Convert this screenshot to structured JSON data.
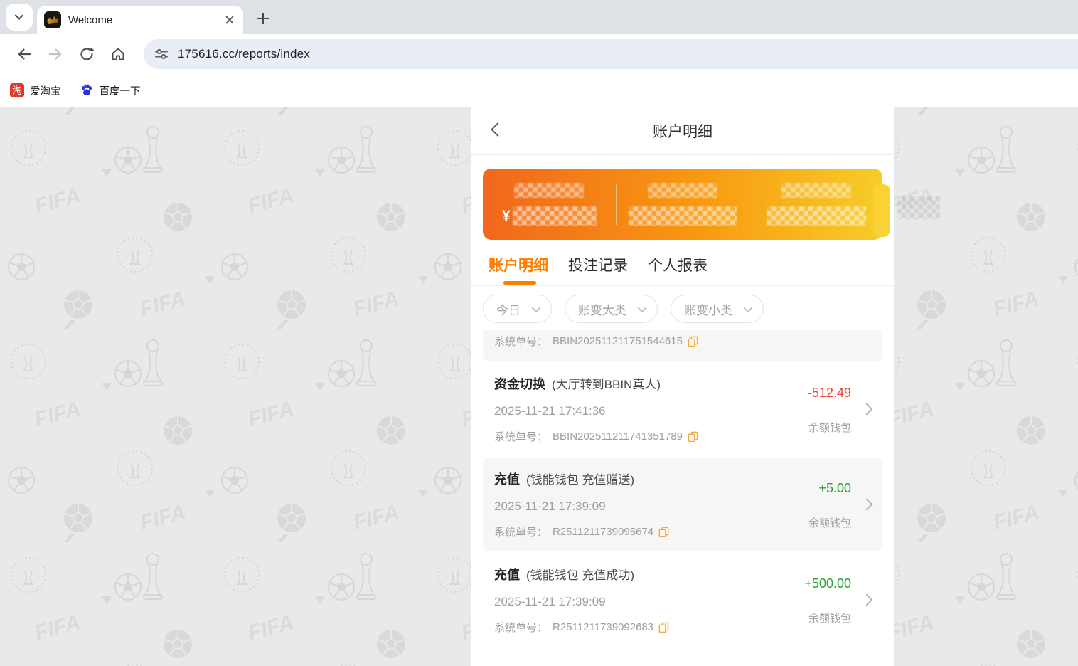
{
  "browser": {
    "tab": {
      "title": "Welcome"
    },
    "url": "175616.cc/reports/index",
    "bookmarks": [
      {
        "label": "爱淘宝"
      },
      {
        "label": "百度一下"
      }
    ]
  },
  "page": {
    "header": {
      "title": "账户明细"
    },
    "summary_card": {
      "currency_prefix": "¥",
      "items": [
        {
          "label_masked": "████",
          "value_masked": "¥██████"
        },
        {
          "label_masked": "████",
          "value_masked": "████████"
        },
        {
          "label_masked": "████",
          "value_masked": "███████"
        }
      ]
    },
    "tabs": [
      {
        "label": "账户明细",
        "active": true
      },
      {
        "label": "投注记录",
        "active": false
      },
      {
        "label": "个人报表",
        "active": false
      }
    ],
    "filters": [
      {
        "label": "今日"
      },
      {
        "label": "账变大类"
      },
      {
        "label": "账变小类"
      }
    ],
    "list": {
      "order_label": "系统单号：",
      "rows": [
        {
          "partial": true,
          "order_no": "BBIN202511211751544615"
        },
        {
          "title": "资金切换",
          "subtitle": "(大厅转到BBIN真人)",
          "datetime": "2025-11-21 17:41:36",
          "order_no": "BBIN202511211741351789",
          "amount": "-512.49",
          "wallet": "余额钱包"
        },
        {
          "title": "充值",
          "subtitle": "(钱能钱包 充值赠送)",
          "datetime": "2025-11-21 17:39:09",
          "order_no": "R2511211739095674",
          "amount": "+5.00",
          "wallet": "余额钱包"
        },
        {
          "title": "充值",
          "subtitle": "(钱能钱包 充值成功)",
          "datetime": "2025-11-21 17:39:09",
          "order_no": "R2511211739092683",
          "amount": "+500.00",
          "wallet": "余额钱包"
        }
      ]
    }
  },
  "colors": {
    "accent_orange": "#fe7e00",
    "card_gradient_left": "#f1671c",
    "card_gradient_right": "#f6cd29",
    "amount_negative": "#e84335",
    "amount_positive": "#2aa52e",
    "tabstrip_bg": "#dee1e6",
    "urlbar_bg": "#e9edf6"
  }
}
